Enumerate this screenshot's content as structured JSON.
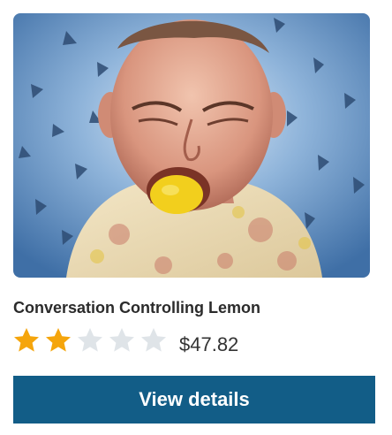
{
  "product": {
    "image_alt": "Man biting a lemon against a blue background with triangles",
    "title": "Conversation Controlling Lemon",
    "rating": 2,
    "rating_max": 5,
    "price": "$47.82",
    "cta_label": "View details"
  },
  "colors": {
    "star_filled": "#f5a50c",
    "star_empty": "#dfe4e8",
    "button_bg": "#125d87",
    "button_text": "#ffffff",
    "title_text": "#2b2b2b",
    "price_text": "#333333"
  }
}
